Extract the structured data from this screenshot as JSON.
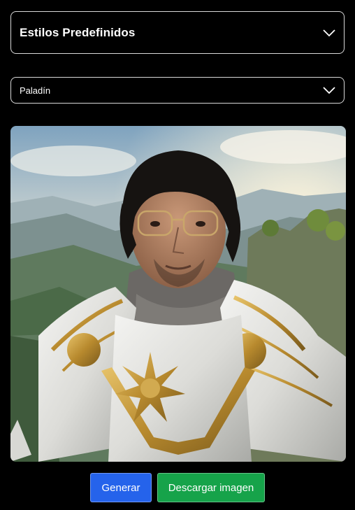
{
  "styles_dropdown": {
    "label": "Estilos Predefinidos",
    "icon": "chevron-down-icon"
  },
  "preset_select": {
    "selected": "Paladín",
    "icon": "chevron-down-icon"
  },
  "generated_image": {
    "subject": "portrait"
  },
  "actions": {
    "generate_label": "Generar",
    "download_label": "Descargar imagen"
  },
  "colors": {
    "background": "#000000",
    "border": "#d9d9d9",
    "generate_button": "#2563eb",
    "download_button": "#16a34a"
  }
}
